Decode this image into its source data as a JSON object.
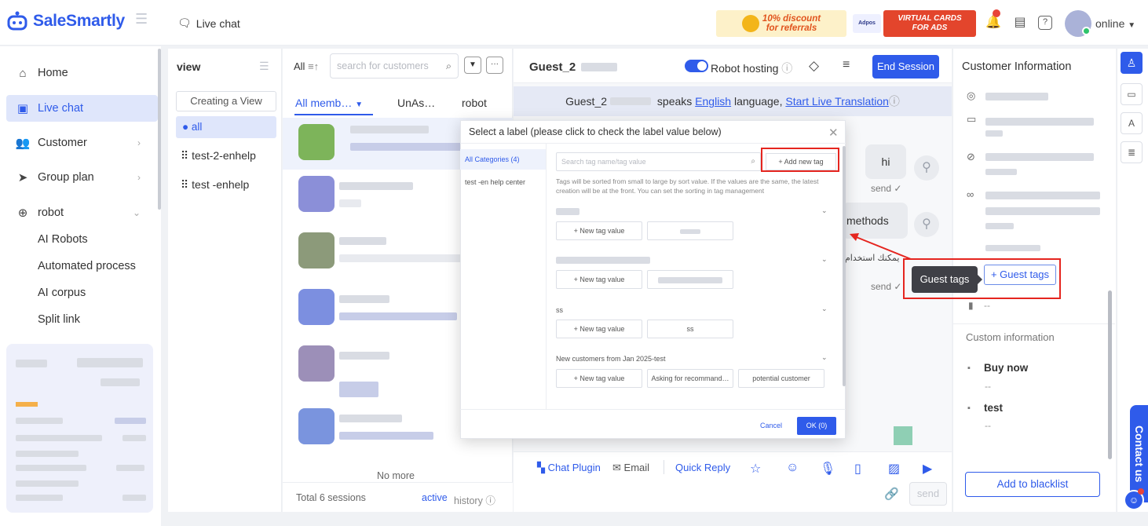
{
  "app": {
    "logo_text": "SaleSmartly",
    "breadcrumb": "Live chat"
  },
  "promos": {
    "discount": "10% discount",
    "discount_sub": "for referrals",
    "ad_brand": "Adpos",
    "virtual_cards": "VIRTUAL CARDS",
    "virtual_cards_sub": "FOR ADS"
  },
  "user": {
    "status": "online"
  },
  "sidebar": {
    "home": "Home",
    "live_chat": "Live chat",
    "customer": "Customer",
    "group_plan": "Group plan",
    "robot": "robot",
    "robot_children": [
      "AI Robots",
      "Automated process",
      "AI corpus",
      "Split link"
    ]
  },
  "views": {
    "title": "view",
    "create_button": "Creating a View",
    "items": [
      "all",
      "test-2-enhelp",
      "test -enhelp"
    ]
  },
  "sessions": {
    "filter_label": "All",
    "search_placeholder": "search for customers",
    "tabs": [
      "All memb…",
      "UnAs…",
      "robot"
    ],
    "no_more": "No more",
    "total": "Total 6 sessions",
    "active_label": "active",
    "history_label": "history"
  },
  "chat": {
    "guest_name": "Guest_2",
    "robot_hosting": "Robot hosting",
    "end_session": "End Session",
    "language_notice_pre": "speaks",
    "language": "English",
    "language_notice_mid": "language,",
    "live_translation": "Start Live Translation",
    "messages": [
      "hi",
      "methods"
    ],
    "arabic_text": "يمكنك استخدام",
    "send_status": "send",
    "toolbar": {
      "chat_plugin": "Chat Plugin",
      "email": "Email",
      "quick_reply": "Quick Reply",
      "send": "send"
    }
  },
  "modal": {
    "title": "Select a label (please click to check the label value below)",
    "categories": [
      "All Categories (4)",
      "test -en help center"
    ],
    "search_placeholder": "Search tag name/tag value",
    "add_new_tag": "+ Add new tag",
    "note": "Tags will be sorted from small to large by sort value. If the values are the same, the latest creation will be at the front. You can set the sorting in tag management",
    "new_tag_value": "+ New tag value",
    "groups": [
      {
        "name": "",
        "values": [
          ""
        ]
      },
      {
        "name": "",
        "values": [
          ""
        ]
      },
      {
        "name": "ss",
        "values": [
          "ss"
        ]
      },
      {
        "name": "New customers from Jan 2025-test",
        "values": [
          "Asking for recommand…",
          "potential customer"
        ]
      }
    ],
    "cancel": "Cancel",
    "ok": "OK (0)"
  },
  "info": {
    "title": "Customer Information",
    "guest_tags_button": "+ Guest tags",
    "tooltip": "Guest tags",
    "tags_empty": "--",
    "custom_info": "Custom information",
    "fields": [
      {
        "name": "Buy now",
        "value": "--"
      },
      {
        "name": "test",
        "value": "--"
      }
    ],
    "blacklist": "Add to blacklist"
  },
  "rail": {
    "contact_us": "Contact us"
  },
  "colors": {
    "brand": "#2f5bea",
    "annotation": "#e5251f",
    "selected_bg": "#dfe6fb"
  }
}
